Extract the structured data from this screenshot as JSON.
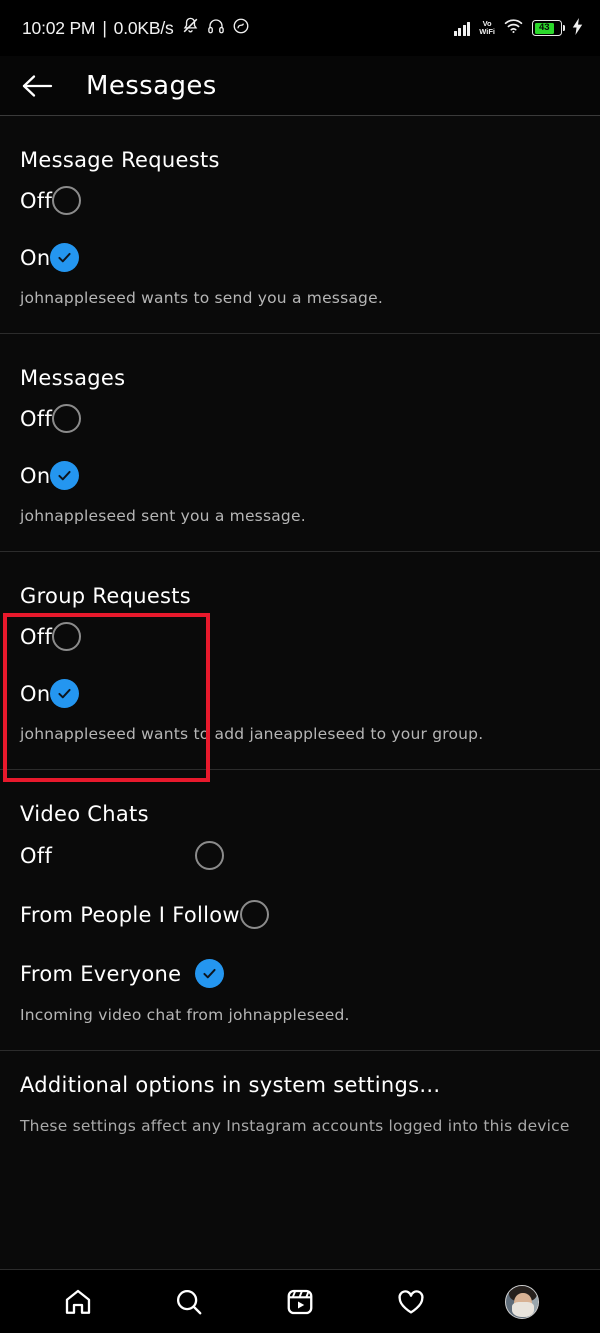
{
  "status_bar": {
    "time": "10:02 PM",
    "separator": "|",
    "network_speed": "0.0KB/s",
    "icons_left": [
      "bell-mute-icon",
      "headphones-icon",
      "dnd-icon"
    ],
    "icons_right": [
      "signal-icon",
      "vowifi-icon",
      "wifi-icon",
      "battery-icon",
      "charging-bolt-icon"
    ],
    "vowifi_line1": "Vo",
    "vowifi_line2": "WiFi",
    "battery_percent": "43"
  },
  "header": {
    "back_icon": "arrow-left-icon",
    "title": "Messages"
  },
  "sections": [
    {
      "id": "message-requests",
      "title": "Message Requests",
      "options": [
        {
          "label": "Off",
          "selected": false
        },
        {
          "label": "On",
          "selected": true
        }
      ],
      "description": "johnappleseed wants to send you a message."
    },
    {
      "id": "messages",
      "title": "Messages",
      "options": [
        {
          "label": "Off",
          "selected": false
        },
        {
          "label": "On",
          "selected": true
        }
      ],
      "description": "johnappleseed sent you a message."
    },
    {
      "id": "group-requests",
      "title": "Group Requests",
      "options": [
        {
          "label": "Off",
          "selected": false
        },
        {
          "label": "On",
          "selected": true
        }
      ],
      "description": "johnappleseed wants to add janeappleseed to your group."
    },
    {
      "id": "video-chats",
      "title": "Video Chats",
      "options": [
        {
          "label": "Off",
          "selected": false
        },
        {
          "label": "From People I Follow",
          "selected": false
        },
        {
          "label": "From Everyone",
          "selected": true
        }
      ],
      "description": "Incoming video chat from johnappleseed."
    }
  ],
  "additional": {
    "title": "Additional options in system settings...",
    "description": "These settings affect any Instagram accounts logged into this device"
  },
  "bottom_nav": [
    {
      "icon": "home-icon",
      "label": "Home"
    },
    {
      "icon": "search-icon",
      "label": "Search"
    },
    {
      "icon": "reels-icon",
      "label": "Reels"
    },
    {
      "icon": "heart-icon",
      "label": "Activity"
    },
    {
      "icon": "avatar-icon",
      "label": "Profile"
    }
  ],
  "highlight": {
    "target": "group-requests",
    "color": "#e8192c"
  },
  "colors": {
    "background": "#0a0a0a",
    "accent_blue": "#2496f0",
    "radio_outline": "#8b8b8b",
    "text_primary": "#ffffff",
    "text_secondary": "#b6b6b6",
    "divider": "#2c2c2c",
    "battery_green": "#2bd82b",
    "highlight_red": "#e8192c"
  }
}
